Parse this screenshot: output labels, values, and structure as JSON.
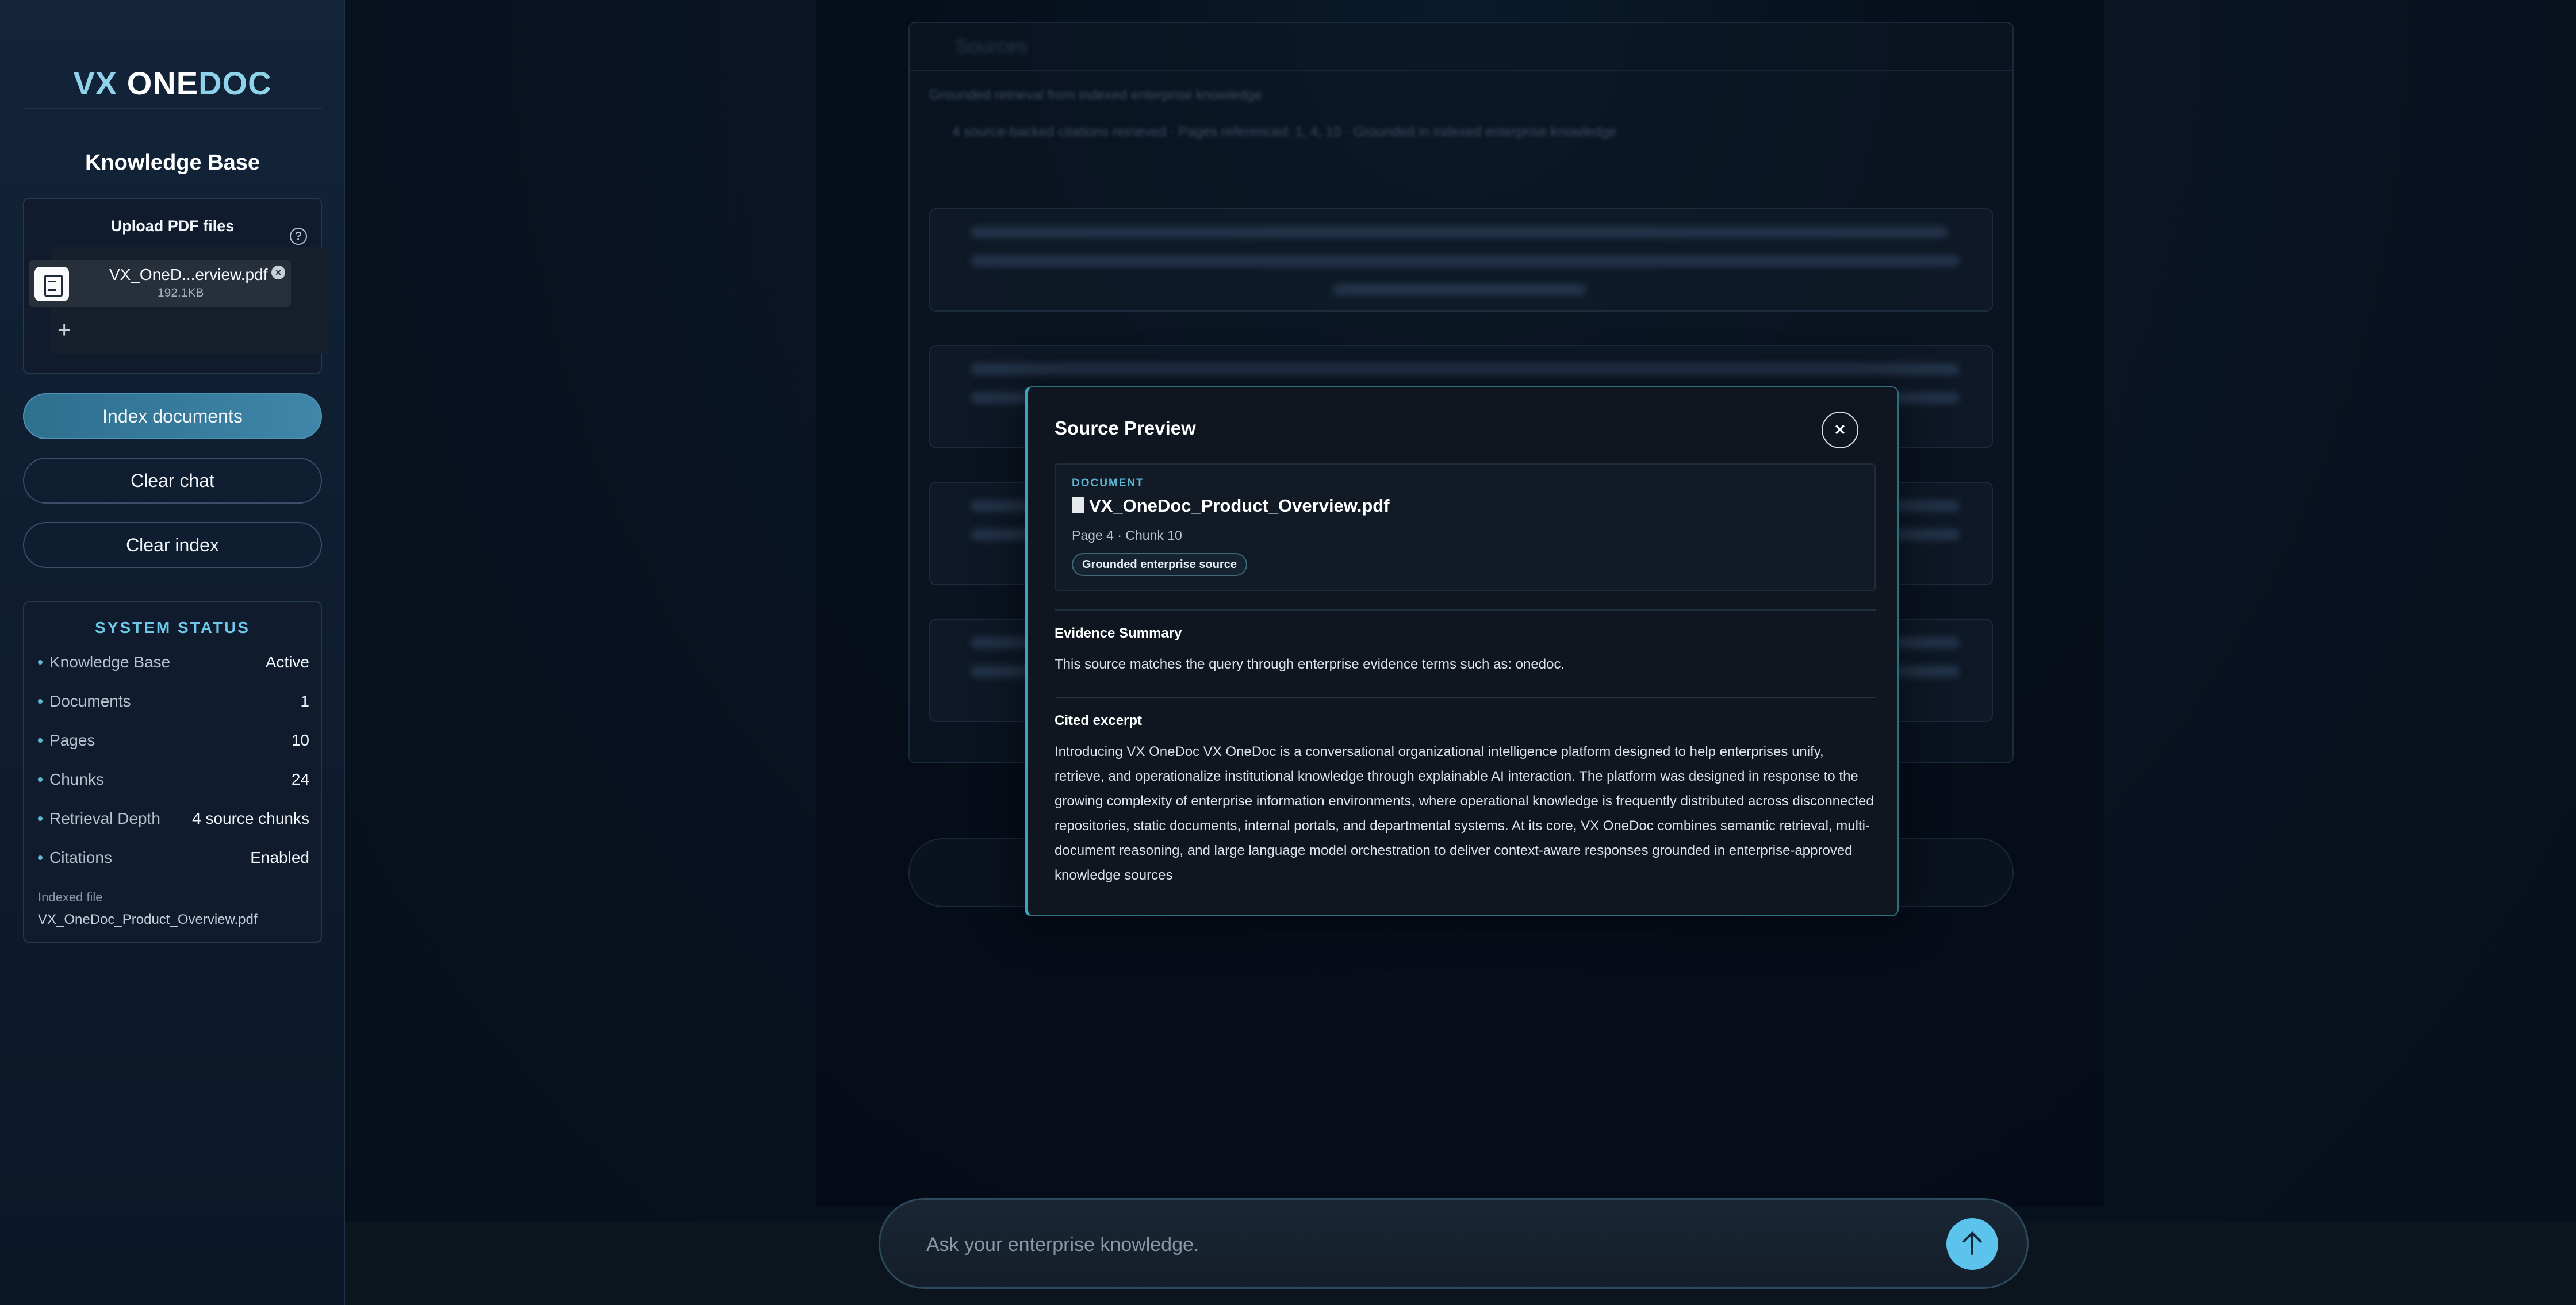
{
  "sidebar": {
    "logo": {
      "vx": "VX",
      "one": "ONE",
      "doc": "DOC"
    },
    "title": "Knowledge Base",
    "upload": {
      "title": "Upload PDF files",
      "help_icon": "help-circle-icon",
      "file": {
        "name": "VX_OneD...erview.pdf",
        "size": "192.1KB"
      },
      "add_icon": "plus-icon"
    },
    "buttons": {
      "index": "Index documents",
      "clear_chat": "Clear chat",
      "clear_index": "Clear index"
    },
    "status": {
      "title": "SYSTEM STATUS",
      "rows": [
        {
          "label": "Knowledge Base",
          "value": "Active"
        },
        {
          "label": "Documents",
          "value": "1"
        },
        {
          "label": "Pages",
          "value": "10"
        },
        {
          "label": "Chunks",
          "value": "24"
        },
        {
          "label": "Retrieval Depth",
          "value": "4 source chunks"
        },
        {
          "label": "Citations",
          "value": "Enabled"
        }
      ],
      "indexed_label": "Indexed file",
      "indexed_file": "VX_OneDoc_Product_Overview.pdf"
    }
  },
  "background": {
    "header": "Sources",
    "subtitle": "Grounded retrieval from indexed enterprise knowledge",
    "summary": "4 source-backed citations retrieved · Pages referenced: 1, 4, 10 · Grounded in indexed enterprise knowledge"
  },
  "chat": {
    "placeholder": "Ask your enterprise knowledge.",
    "send_icon": "arrow-up-icon"
  },
  "modal": {
    "title": "Source Preview",
    "close_icon": "close-icon",
    "close_label": "×",
    "document": {
      "kicker": "DOCUMENT",
      "name": "VX_OneDoc_Product_Overview.pdf",
      "meta": "Page 4 · Chunk 10",
      "badge": "Grounded enterprise source"
    },
    "evidence": {
      "heading": "Evidence Summary",
      "text": "This source matches the query through enterprise evidence terms such as: onedoc."
    },
    "excerpt": {
      "heading": "Cited excerpt",
      "text": "Introducing VX OneDoc VX OneDoc is a conversational organizational intelligence platform designed to help enterprises unify, retrieve, and operationalize institutional knowledge through explainable AI interaction. The platform was designed in response to the growing complexity of enterprise information environments, where operational knowledge is frequently distributed across disconnected repositories, static documents, internal portals, and departmental systems. At its core, VX OneDoc combines semantic retrieval, multi-document reasoning, and large language model orchestration to deliver context-aware responses grounded in enterprise-approved knowledge sources"
    }
  },
  "colors": {
    "accent": "#5cc4ec",
    "logo_accent": "#8fd3ea",
    "primary_button": "#3f86a8",
    "modal_border": "#3aa3bf"
  }
}
